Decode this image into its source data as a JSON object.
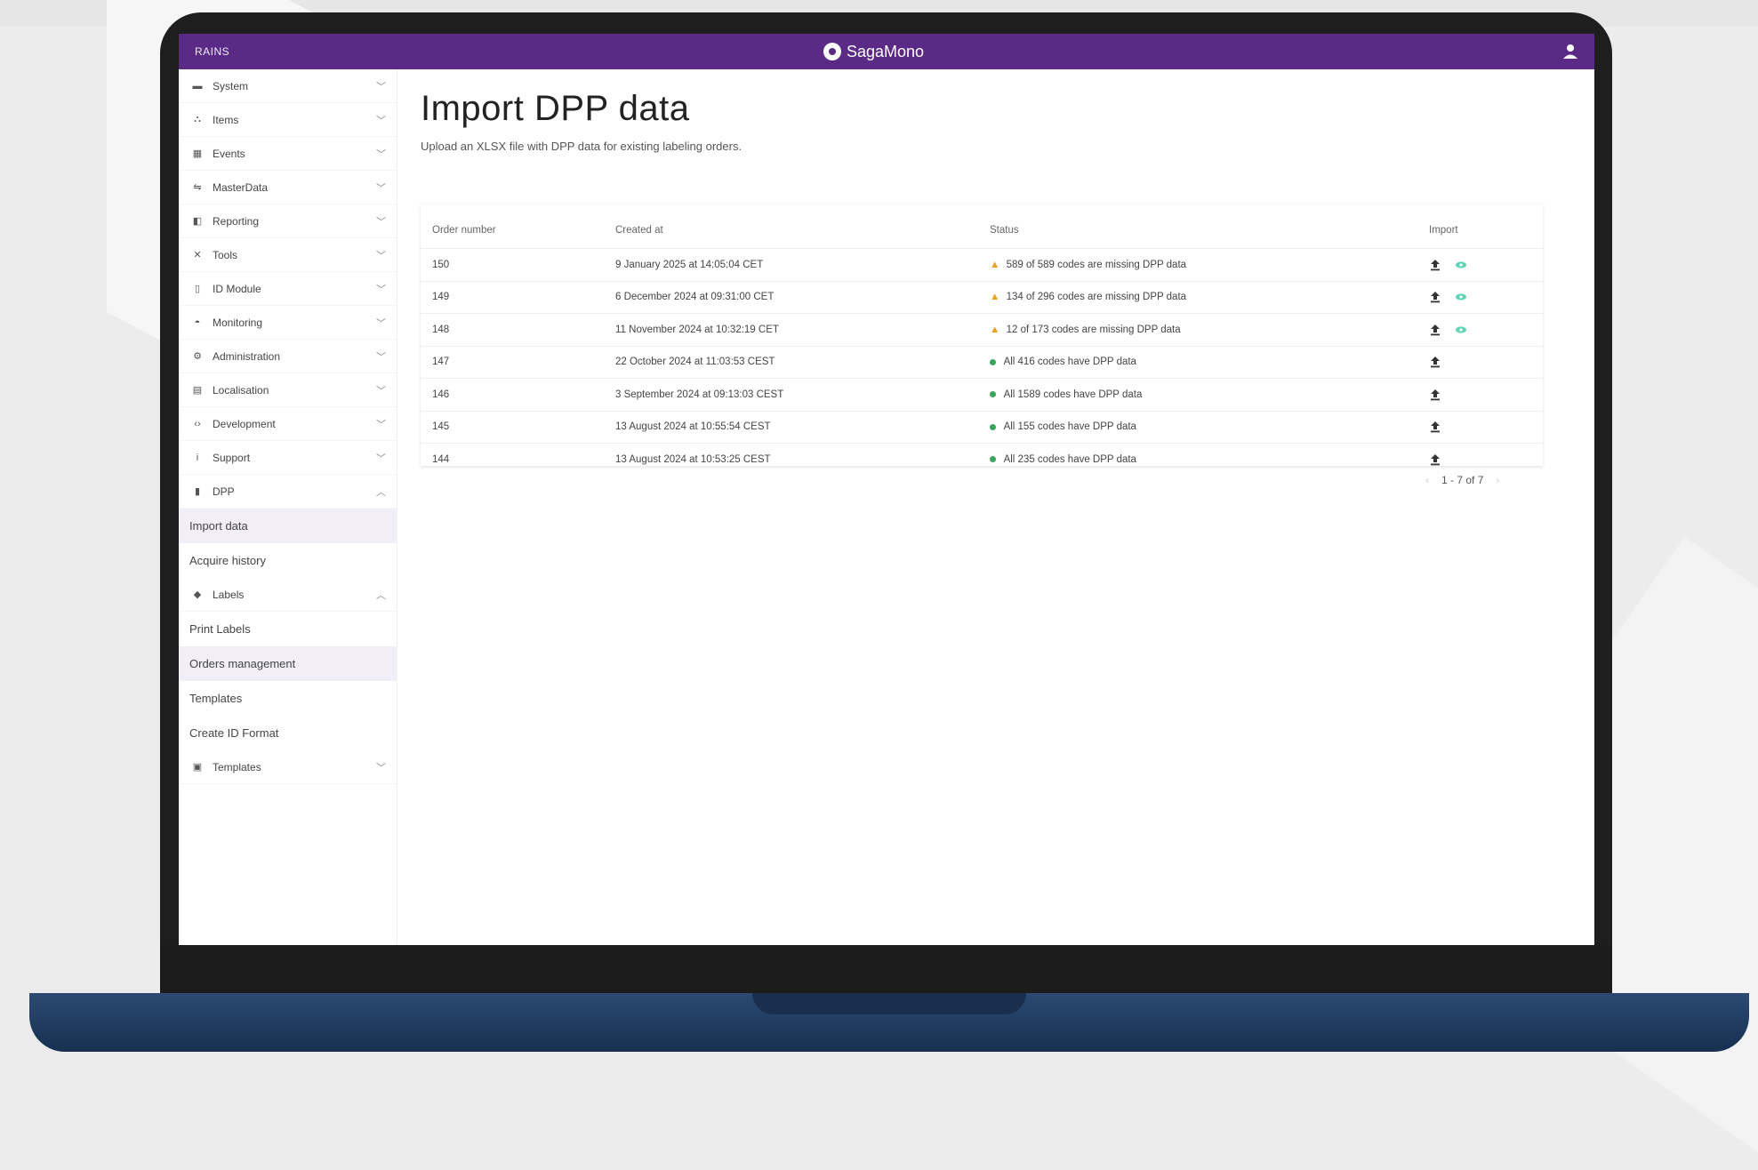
{
  "topbar": {
    "brand_left": "RAINS",
    "logo_text": "SagaMono"
  },
  "sidebar": {
    "items": [
      {
        "label": "System",
        "icon": "server-icon",
        "expanded": false
      },
      {
        "label": "Items",
        "icon": "hierarchy-icon",
        "expanded": false
      },
      {
        "label": "Events",
        "icon": "calendar-icon",
        "expanded": false
      },
      {
        "label": "MasterData",
        "icon": "masterdata-icon",
        "expanded": false
      },
      {
        "label": "Reporting",
        "icon": "reporting-icon",
        "expanded": false
      },
      {
        "label": "Tools",
        "icon": "tools-icon",
        "expanded": false
      },
      {
        "label": "ID Module",
        "icon": "id-module-icon",
        "expanded": false
      },
      {
        "label": "Monitoring",
        "icon": "monitoring-icon",
        "expanded": false
      },
      {
        "label": "Administration",
        "icon": "admin-icon",
        "expanded": false
      },
      {
        "label": "Localisation",
        "icon": "localisation-icon",
        "expanded": false
      },
      {
        "label": "Development",
        "icon": "code-icon",
        "expanded": false
      },
      {
        "label": "Support",
        "icon": "info-icon",
        "expanded": false
      },
      {
        "label": "DPP",
        "icon": "dpp-icon",
        "expanded": true
      }
    ],
    "dpp_sub": [
      {
        "label": "Import data",
        "active": true
      },
      {
        "label": "Acquire history",
        "active": false
      }
    ],
    "labels": {
      "label": "Labels",
      "icon": "tag-icon",
      "expanded": true
    },
    "labels_sub": [
      {
        "label": "Print Labels",
        "active": false
      },
      {
        "label": "Orders management",
        "active": true
      },
      {
        "label": "Templates",
        "active": false
      },
      {
        "label": "Create ID Format",
        "active": false
      }
    ],
    "templates": {
      "label": "Templates",
      "icon": "template-icon",
      "expanded": false
    }
  },
  "main": {
    "title": "Import DPP data",
    "subtitle": "Upload an XLSX file with DPP data for existing labeling orders.",
    "table": {
      "headers": [
        "Order number",
        "Created at",
        "Status",
        "Import"
      ],
      "rows": [
        {
          "order": "150",
          "created": "9 January 2025 at 14:05:04 CET",
          "status": "589 of 589 codes are missing DPP data",
          "state": "warning",
          "view": true
        },
        {
          "order": "149",
          "created": "6 December 2024 at 09:31:00 CET",
          "status": "134 of 296 codes are missing DPP data",
          "state": "warning",
          "view": true
        },
        {
          "order": "148",
          "created": "11 November 2024 at 10:32:19 CET",
          "status": "12 of 173 codes are missing DPP data",
          "state": "warning",
          "view": true
        },
        {
          "order": "147",
          "created": "22 October 2024 at 11:03:53 CEST",
          "status": "All 416 codes have DPP data",
          "state": "ok",
          "view": false
        },
        {
          "order": "146",
          "created": "3 September 2024 at 09:13:03 CEST",
          "status": "All 1589 codes have DPP data",
          "state": "ok",
          "view": false
        },
        {
          "order": "145",
          "created": "13 August 2024 at 10:55:54 CEST",
          "status": "All 155 codes have DPP data",
          "state": "ok",
          "view": false
        },
        {
          "order": "144",
          "created": "13 August 2024 at 10:53:25 CEST",
          "status": "All 235 codes have DPP data",
          "state": "ok",
          "view": false
        }
      ]
    },
    "pagination": "1 - 7 of 7"
  },
  "colors": {
    "topbar": "#5b2a86",
    "active_bg": "#f2eef7",
    "warning": "#f0a020",
    "ok": "#3aa65a",
    "view_icon": "#5fd3b8"
  }
}
